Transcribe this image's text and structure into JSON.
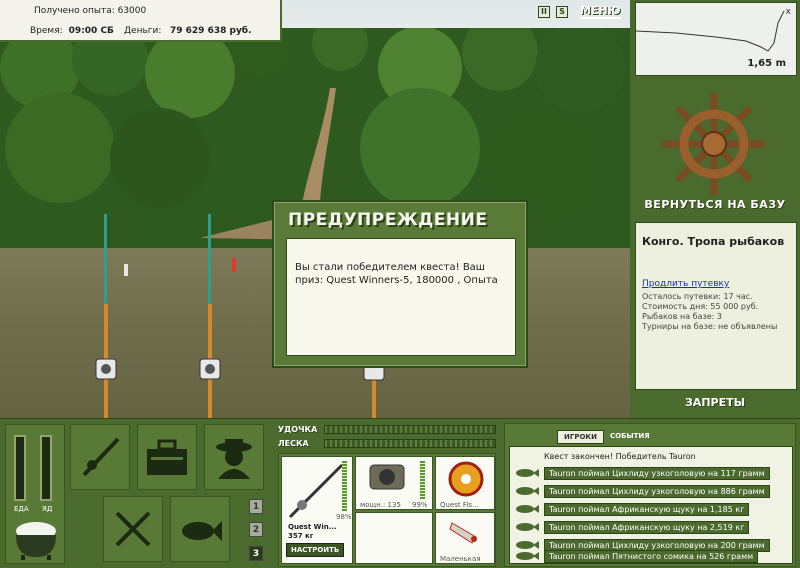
{
  "hud": {
    "exp_label": "Получено опыта: 63000",
    "time_label": "Время:",
    "time_value": "09:00 СБ",
    "money_label": "Деньги:",
    "money_value": "79 629 638 руб.",
    "menu_label": "МЕНЮ",
    "pause_icon": "II",
    "sound_icon": "S"
  },
  "depth": {
    "value": "1,65 m",
    "close": "x"
  },
  "right": {
    "back_label": "ВЕРНУТЬСЯ НА БАЗУ",
    "location_title": "Конго. Тропа рыбаков",
    "extend_link": "Продлить путевку",
    "voucher_left": "Осталось путевки: 17 час.",
    "day_cost": "Стоимость дня: 55 000 руб.",
    "fishers_at_base": "Рыбаков на базе: 3",
    "tournaments": "Турниры на базе: не объявлены",
    "ban_label": "ЗАПРЕТЫ"
  },
  "dialog": {
    "title": "ПРЕДУПРЕЖДЕНИЕ",
    "message": "Вы стали победителем квеста! Ваш приз: Quest Winners-5, 180000 , Опыта"
  },
  "gauges": {
    "food_label": "ЕДА",
    "poison_label": "ЯД"
  },
  "tabs": [
    "1",
    "2",
    "3"
  ],
  "lines": {
    "rod_label": "УДОЧКА",
    "line_label": "ЛЕСКА"
  },
  "tackle": {
    "rod_name": "Quest Win...",
    "rod_weight": "357 кг",
    "rod_percent": "98%",
    "reel_info": "мощн.: 135",
    "reel_percent": "99%",
    "line_name": "Quest Fis...",
    "lure_name": "Маленькая",
    "setup_label": "НАСТРОИТЬ"
  },
  "log": {
    "tab_players": "ИГРОКИ",
    "tab_events": "СОБЫТИЯ",
    "header": "Квест закончен! Победитель Tauron",
    "entries": [
      "Tauron поймал Цихлиду узкоголовую на 117 грамм",
      "Tauron поймал Цихлиду узкоголовую на 886 грамм",
      "Tauron поймал Африканскую щуку на 1,185 кг",
      "Tauron поймал Африканскую щуку на 2,519 кг",
      "Tauron поймал Цихлиду узкоголовую на 200 грамм",
      "Tauron поймал Пятнистого сомика на 526 грамм"
    ]
  },
  "colors": {
    "panel_green": "#4b6a2e",
    "dark_green": "#2d4419",
    "paper": "#f4f4ec"
  }
}
